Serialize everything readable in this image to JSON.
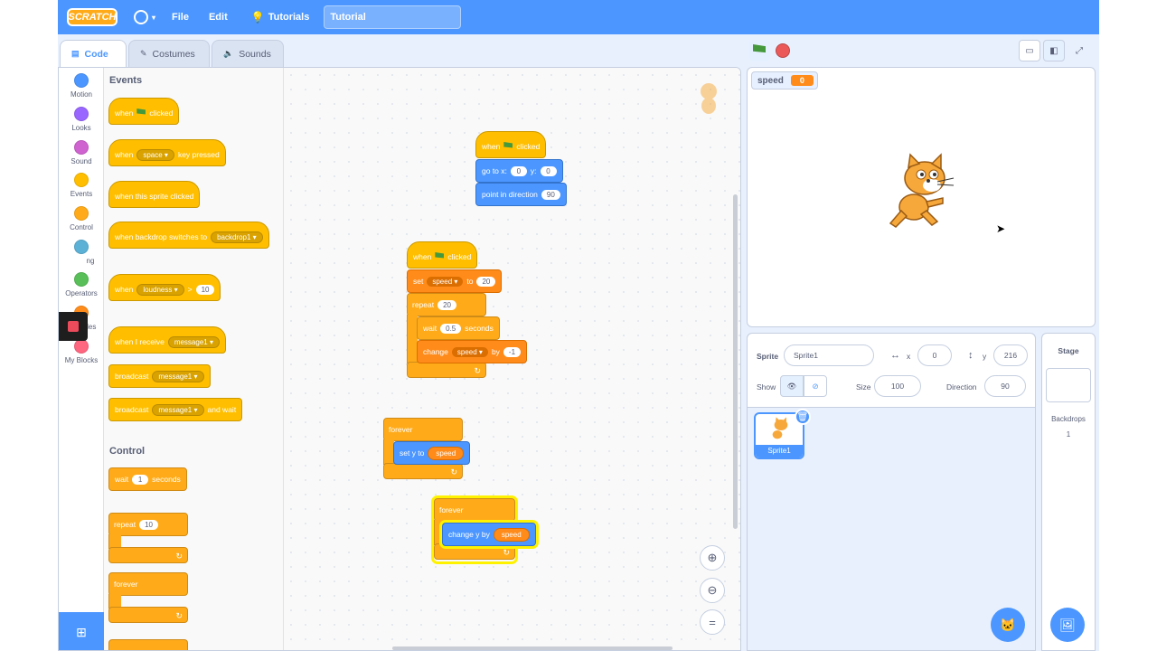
{
  "menubar": {
    "logo": "SCRATCH",
    "file": "File",
    "edit": "Edit",
    "tutorials": "Tutorials",
    "project_title": "Tutorial"
  },
  "tabs": {
    "code": "Code",
    "costumes": "Costumes",
    "sounds": "Sounds"
  },
  "categories": [
    {
      "label": "Motion",
      "color": "#4c97ff"
    },
    {
      "label": "Looks",
      "color": "#9966ff"
    },
    {
      "label": "Sound",
      "color": "#cf63cf"
    },
    {
      "label": "Events",
      "color": "#ffbf00"
    },
    {
      "label": "Control",
      "color": "#ffab19"
    },
    {
      "label": "ng",
      "color": "#5cb1d6"
    },
    {
      "label": "Operators",
      "color": "#59c059"
    },
    {
      "label": "Variables",
      "color": "#ff8c1a"
    },
    {
      "label": "My Blocks",
      "color": "#ff6680"
    }
  ],
  "palette": {
    "events_title": "Events",
    "control_title": "Control",
    "when": "when",
    "clicked": "clicked",
    "space": "space",
    "key_pressed": "key pressed",
    "when_this_sprite_clicked": "when this sprite clicked",
    "when_backdrop_switches_to": "when backdrop switches to",
    "backdrop1": "backdrop1",
    "loudness": "loudness",
    "gt": ">",
    "ten": "10",
    "when_i_receive": "when I receive",
    "message1": "message1",
    "broadcast": "broadcast",
    "and_wait": "and wait",
    "wait": "wait",
    "one": "1",
    "seconds": "seconds",
    "repeat": "repeat",
    "forever": "forever"
  },
  "scripts": {
    "s1": {
      "when": "when",
      "clicked": "clicked",
      "goto": "go to x:",
      "x": "0",
      "y_label": "y:",
      "y": "0",
      "point": "point in direction",
      "dir": "90"
    },
    "s2": {
      "when": "when",
      "clicked": "clicked",
      "set": "set",
      "var": "speed",
      "to": "to",
      "val": "20",
      "repeat": "repeat",
      "rep": "20",
      "wait": "wait",
      "wait_val": "0.5",
      "seconds": "seconds",
      "change": "change",
      "by": "by",
      "by_val": "-1"
    },
    "s3": {
      "forever": "forever",
      "sety": "set y to",
      "var": "speed"
    },
    "s4": {
      "forever": "forever",
      "changey": "change y by",
      "var": "speed"
    }
  },
  "stage": {
    "monitor_label": "speed",
    "monitor_value": "0"
  },
  "sprite_info": {
    "sprite_label": "Sprite",
    "sprite_name": "Sprite1",
    "x_label": "x",
    "x": "0",
    "y_label": "y",
    "y": "216",
    "show_label": "Show",
    "size_label": "Size",
    "size": "100",
    "direction_label": "Direction",
    "direction": "90",
    "thumb_label": "Sprite1"
  },
  "stage_pane": {
    "title": "Stage",
    "backdrops_label": "Backdrops",
    "backdrops_count": "1"
  }
}
